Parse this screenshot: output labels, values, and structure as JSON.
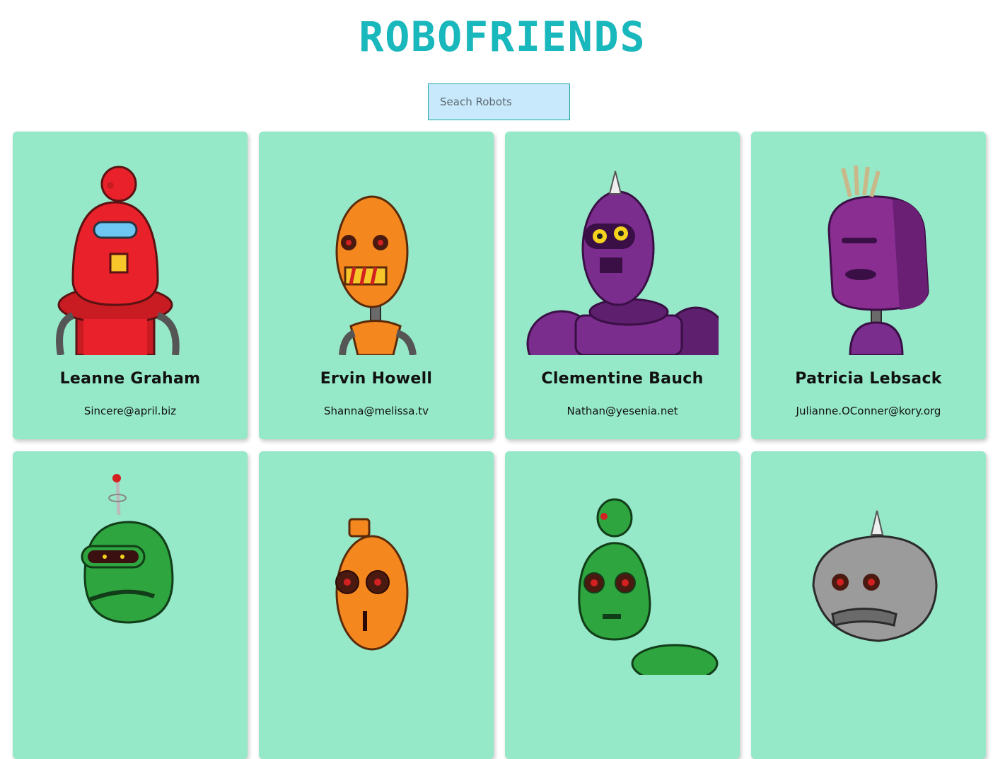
{
  "header": {
    "title": "ROBOFRIENDS"
  },
  "search": {
    "placeholder": "Seach Robots",
    "value": ""
  },
  "robots": [
    {
      "name": "Leanne Graham",
      "email": "Sincere@april.biz",
      "color": "#e8212a",
      "icon": "red-robot-avatar"
    },
    {
      "name": "Ervin Howell",
      "email": "Shanna@melissa.tv",
      "color": "#f4881f",
      "icon": "orange-robot-avatar"
    },
    {
      "name": "Clementine Bauch",
      "email": "Nathan@yesenia.net",
      "color": "#7b2d8e",
      "icon": "purple-robot-avatar"
    },
    {
      "name": "Patricia Lebsack",
      "email": "Julianne.OConner@kory.org",
      "color": "#8a2e92",
      "icon": "purple-robot-avatar"
    },
    {
      "name": "",
      "email": "",
      "color": "#2ea53f",
      "icon": "green-robot-avatar"
    },
    {
      "name": "",
      "email": "",
      "color": "#f4881f",
      "icon": "orange-robot-avatar"
    },
    {
      "name": "",
      "email": "",
      "color": "#2ea53f",
      "icon": "green-robot-avatar"
    },
    {
      "name": "",
      "email": "",
      "color": "#9b9b9b",
      "icon": "gray-robot-avatar"
    }
  ],
  "colors": {
    "card_bg": "#95e8c8",
    "logo": "#18b8bd",
    "search_bg": "#c8e8fb"
  }
}
